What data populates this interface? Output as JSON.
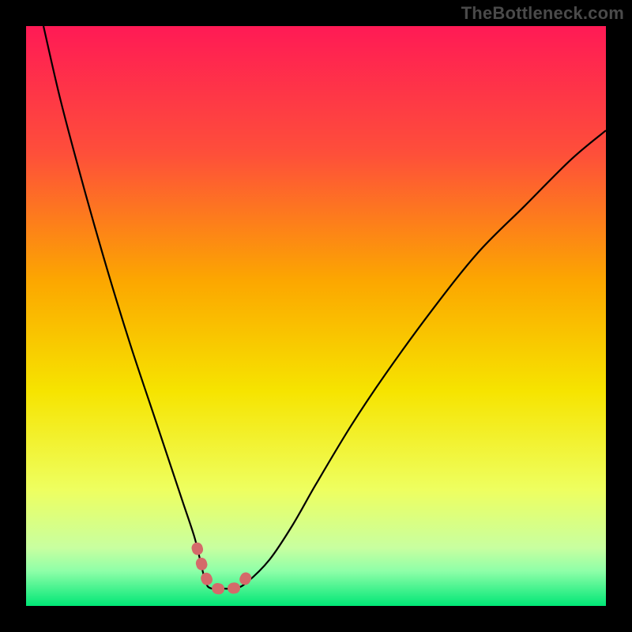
{
  "watermark": {
    "text": "TheBottleneck.com"
  },
  "chart_data": {
    "type": "line",
    "title": "",
    "xlabel": "",
    "ylabel": "",
    "xlim": [
      0,
      100
    ],
    "ylim": [
      0,
      100
    ],
    "series": [
      {
        "name": "bottleneck-curve",
        "x": [
          3,
          6,
          10,
          14,
          18,
          22,
          25,
          27,
          29,
          30,
          31,
          32,
          34,
          36,
          38,
          42,
          46,
          50,
          56,
          62,
          70,
          78,
          86,
          94,
          100
        ],
        "y": [
          100,
          87,
          72,
          58,
          45,
          33,
          24,
          18,
          12,
          8,
          4,
          3,
          3,
          3,
          4,
          8,
          14,
          21,
          31,
          40,
          51,
          61,
          69,
          77,
          82
        ]
      }
    ],
    "highlight_segment": {
      "name": "optimal-range",
      "x": [
        29.5,
        30.5,
        31.5,
        33,
        35,
        37,
        38.5
      ],
      "y": [
        10,
        6.5,
        4,
        3,
        3,
        3.5,
        6
      ]
    },
    "background_gradient": {
      "stops": [
        {
          "offset": 0.0,
          "color": "#ff1a55"
        },
        {
          "offset": 0.22,
          "color": "#fe4f3a"
        },
        {
          "offset": 0.44,
          "color": "#fca700"
        },
        {
          "offset": 0.63,
          "color": "#f6e400"
        },
        {
          "offset": 0.8,
          "color": "#eeff60"
        },
        {
          "offset": 0.9,
          "color": "#c8ffa0"
        },
        {
          "offset": 0.94,
          "color": "#8effa8"
        },
        {
          "offset": 1.0,
          "color": "#00e676"
        }
      ]
    },
    "colors": {
      "curve": "#000000",
      "highlight": "#d46a6a",
      "frame": "#000000"
    }
  }
}
